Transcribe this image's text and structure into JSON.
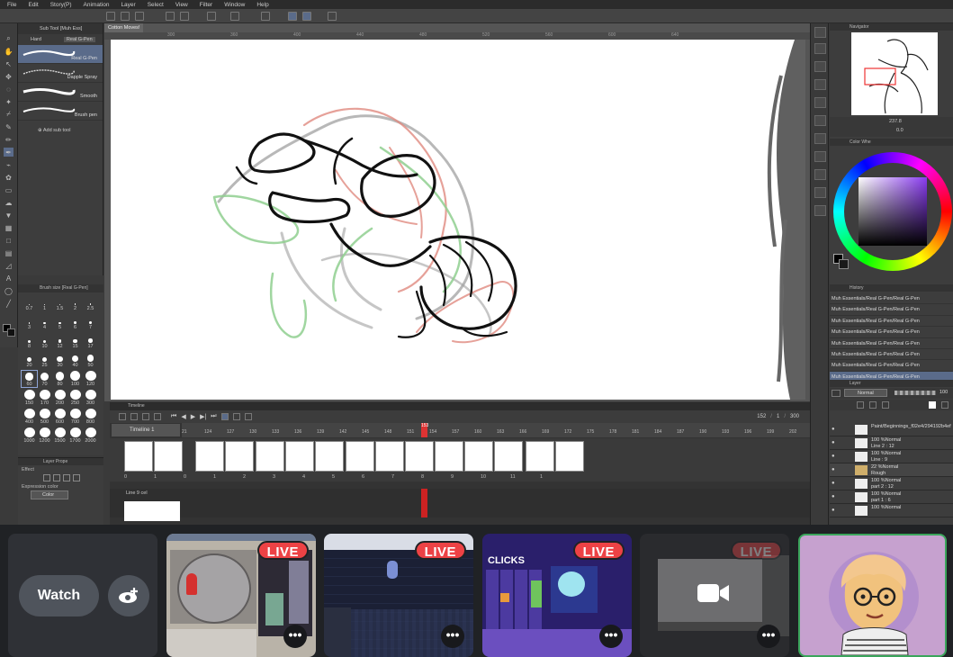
{
  "menu": [
    "File",
    "Edit",
    "Story(P)",
    "Animation",
    "Layer",
    "Select",
    "View",
    "Filter",
    "Window",
    "Help"
  ],
  "doc_tab": "Cotton Moves!",
  "ruler_ticks": [
    "300",
    "360",
    "400",
    "440",
    "480",
    "520",
    "560",
    "600",
    "640"
  ],
  "subtool": {
    "tabs": [
      "Hard",
      "Real G-Pen"
    ],
    "panel_title": "Sub Tool [Muh Ess]",
    "brushes": [
      "Real G-Pen",
      "Dapple Spray",
      "Smooth",
      "Brush pen"
    ],
    "add_label": "Add sub tool"
  },
  "brush_size": {
    "title": "Brush size [Real G-Pen]",
    "sizes": [
      "0.7",
      "1",
      "1.5",
      "2",
      "2.5",
      "3",
      "4",
      "5",
      "6",
      "7",
      "8",
      "10",
      "12",
      "15",
      "17",
      "20",
      "25",
      "30",
      "40",
      "50",
      "60",
      "70",
      "80",
      "100",
      "120",
      "150",
      "170",
      "200",
      "250",
      "300",
      "400",
      "500",
      "600",
      "700",
      "800",
      "1000",
      "1200",
      "1500",
      "1700",
      "2000"
    ]
  },
  "layer_property": {
    "title": "Layer Prope",
    "effect_label": "Effect",
    "expression_label": "Expression color",
    "color_value": "Color"
  },
  "timeline": {
    "title": "Timeline",
    "name": "Timeline 1",
    "frames": [
      "21",
      "124",
      "127",
      "130",
      "133",
      "136",
      "139",
      "142",
      "145",
      "148",
      "151",
      "154",
      "157",
      "160",
      "163",
      "166",
      "169",
      "172",
      "175",
      "178",
      "181",
      "184",
      "187",
      "190",
      "193",
      "196",
      "199",
      "202"
    ],
    "current_frame": "153",
    "total_labels": [
      "152",
      "1",
      "300"
    ],
    "cel_numbers": [
      "0",
      "1",
      "0",
      "1",
      "2",
      "3",
      "4",
      "5",
      "6",
      "7",
      "8",
      "9",
      "10",
      "11",
      "1"
    ],
    "track_label": "Line 9 cel"
  },
  "navigator": {
    "title": "Navigator",
    "zoom": "237.8",
    "angle": "0.0"
  },
  "color_panel": {
    "title": "Color Whe"
  },
  "history": {
    "title": "History",
    "items": [
      "Muh Essentials/Real G-Pen/Real G-Pen",
      "Muh Essentials/Real G-Pen/Real G-Pen",
      "Muh Essentials/Real G-Pen/Real G-Pen",
      "Muh Essentials/Real G-Pen/Real G-Pen",
      "Muh Essentials/Real G-Pen/Real G-Pen",
      "Muh Essentials/Real G-Pen/Real G-Pen",
      "Muh Essentials/Real G-Pen/Real G-Pen",
      "Muh Essentials/Real G-Pen/Real G-Pen"
    ]
  },
  "layer_panel": {
    "title": "Layer",
    "blend": "Normal",
    "opacity": "100",
    "layers": [
      {
        "line1": "Paint/Beginnings_f02e4/294192b4ef",
        "line2": ""
      },
      {
        "line1": "100 %Normal",
        "line2": "Line 2 : 12"
      },
      {
        "line1": "100 %Normal",
        "line2": "Line : 9"
      },
      {
        "line1": "22 %Normal",
        "line2": "Rough"
      },
      {
        "line1": "100 %Normal",
        "line2": "part 2 : 12"
      },
      {
        "line1": "100 %Normal",
        "line2": "part 1 : 6"
      },
      {
        "line1": "100 %Normal",
        "line2": ""
      }
    ]
  },
  "stream_strip": {
    "watch_label": "Watch",
    "live_label": "LIVE",
    "more_label": "•••",
    "game_title": "CLICKS"
  },
  "colors": {
    "accent_live": "#ed4245",
    "selected_row": "#5a6b8a",
    "avatar_bg": "#c6a1cf",
    "tile_highlight": "#3ba55c"
  }
}
